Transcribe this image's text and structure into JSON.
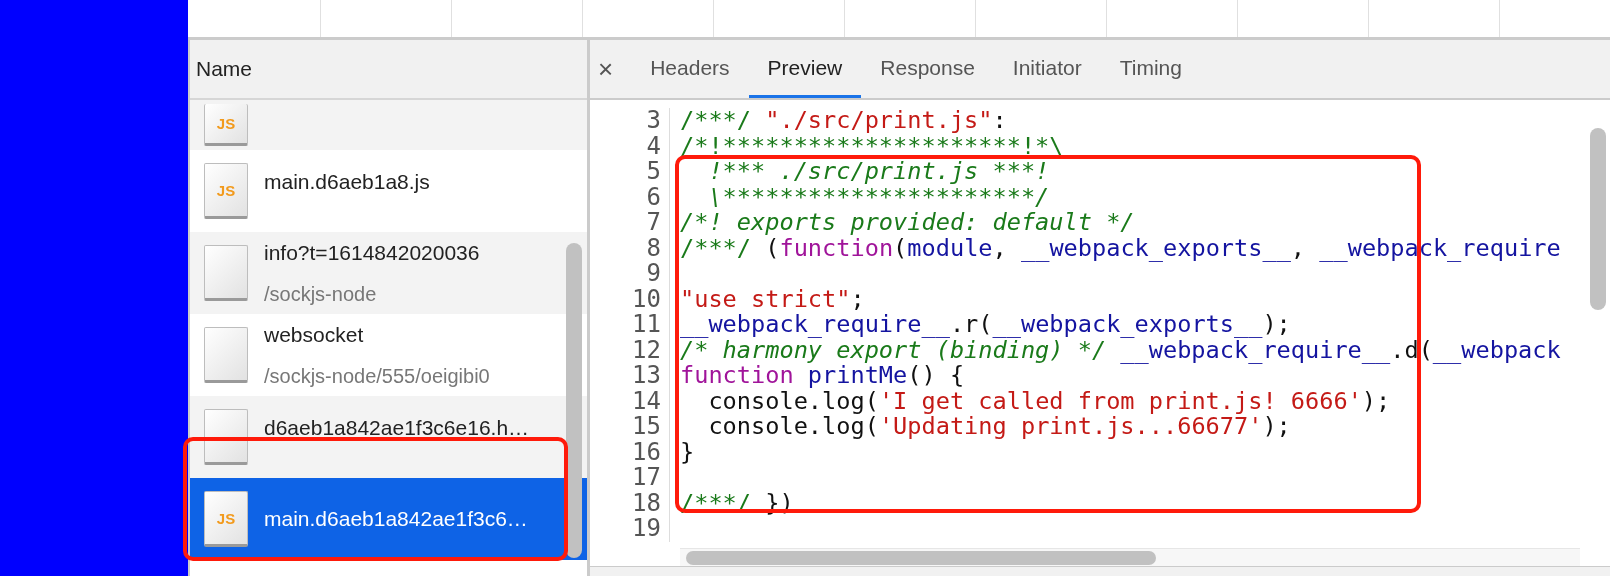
{
  "requests": {
    "column_title": "Name",
    "rows": [
      {
        "kind": "script",
        "badge": "JS",
        "name": "",
        "path": "",
        "selected": false,
        "partial": true
      },
      {
        "kind": "script",
        "badge": "JS",
        "name": "main.d6aeb1a8.js",
        "path": "",
        "selected": false,
        "partial": false
      },
      {
        "kind": "other",
        "name": "info?t=1614842020036",
        "path": "/sockjs-node",
        "selected": false,
        "partial": false
      },
      {
        "kind": "other",
        "name": "websocket",
        "path": "/sockjs-node/555/oeigibi0",
        "selected": false,
        "partial": false
      },
      {
        "kind": "other",
        "name": "d6aeb1a842ae1f3c6e16.h…",
        "path": "",
        "selected": false,
        "partial": false
      },
      {
        "kind": "script",
        "badge": "JS",
        "name": "main.d6aeb1a842ae1f3c6…",
        "path": "",
        "selected": true,
        "partial": false
      }
    ]
  },
  "detail": {
    "close": "×",
    "tabs": [
      {
        "label": "Headers",
        "selected": false
      },
      {
        "label": "Preview",
        "selected": true
      },
      {
        "label": "Response",
        "selected": false
      },
      {
        "label": "Initiator",
        "selected": false
      },
      {
        "label": "Timing",
        "selected": false
      }
    ],
    "code": [
      {
        "number": "3",
        "tokens": [
          {
            "kind": "marker",
            "text": "/***/"
          },
          {
            "kind": "string",
            "text": " \"./src/print.js\""
          },
          {
            "kind": "plain",
            "text": ":"
          }
        ]
      },
      {
        "number": "4",
        "tokens": [
          {
            "kind": "marker",
            "text": "/*!*********************!*\\"
          }
        ]
      },
      {
        "number": "5",
        "tokens": [
          {
            "kind": "comment",
            "text": "  !*** ./src/print.js ***!"
          }
        ]
      },
      {
        "number": "6",
        "tokens": [
          {
            "kind": "comment",
            "text": "  \\**********************/"
          }
        ]
      },
      {
        "number": "7",
        "tokens": [
          {
            "kind": "comment",
            "text": "/*! exports provided: default */"
          }
        ]
      },
      {
        "number": "8",
        "tokens": [
          {
            "kind": "marker",
            "text": "/***/"
          },
          {
            "kind": "plain",
            "text": " ("
          },
          {
            "kind": "keyword",
            "text": "function"
          },
          {
            "kind": "plain",
            "text": "("
          },
          {
            "kind": "name",
            "text": "module"
          },
          {
            "kind": "plain",
            "text": ", "
          },
          {
            "kind": "name",
            "text": "__webpack_exports__"
          },
          {
            "kind": "plain",
            "text": ", "
          },
          {
            "kind": "name",
            "text": "__webpack_require"
          }
        ]
      },
      {
        "number": "9"
      },
      {
        "number": "10",
        "tokens": [
          {
            "kind": "string",
            "text": "\"use strict\""
          },
          {
            "kind": "plain",
            "text": ";"
          }
        ]
      },
      {
        "number": "11",
        "tokens": [
          {
            "kind": "name",
            "text": "__webpack_require__"
          },
          {
            "kind": "plain",
            "text": ".r("
          },
          {
            "kind": "name",
            "text": "__webpack_exports__"
          },
          {
            "kind": "plain",
            "text": ");"
          }
        ]
      },
      {
        "number": "12",
        "tokens": [
          {
            "kind": "comment",
            "text": "/* harmony export (binding) */"
          },
          {
            "kind": "name",
            "text": " __webpack_require__"
          },
          {
            "kind": "plain",
            "text": ".d("
          },
          {
            "kind": "name",
            "text": "__webpack"
          }
        ]
      },
      {
        "number": "13",
        "tokens": [
          {
            "kind": "keyword",
            "text": "function"
          },
          {
            "kind": "name",
            "text": " printMe"
          },
          {
            "kind": "plain",
            "text": "() {"
          }
        ]
      },
      {
        "number": "14",
        "tokens": [
          {
            "kind": "plain",
            "text": "  console.log("
          },
          {
            "kind": "string",
            "text": "'I get called from print.js! 6666'"
          },
          {
            "kind": "plain",
            "text": ");"
          }
        ]
      },
      {
        "number": "15",
        "tokens": [
          {
            "kind": "plain",
            "text": "  console.log("
          },
          {
            "kind": "string",
            "text": "'Updating print.js...66677'"
          },
          {
            "kind": "plain",
            "text": ");"
          }
        ]
      },
      {
        "number": "16",
        "tokens": [
          {
            "kind": "plain",
            "text": "}"
          }
        ]
      },
      {
        "number": "17"
      },
      {
        "number": "18",
        "tokens": [
          {
            "kind": "marker",
            "text": "/***/"
          },
          {
            "kind": "plain",
            "text": " })"
          }
        ]
      },
      {
        "number": "19"
      }
    ]
  }
}
